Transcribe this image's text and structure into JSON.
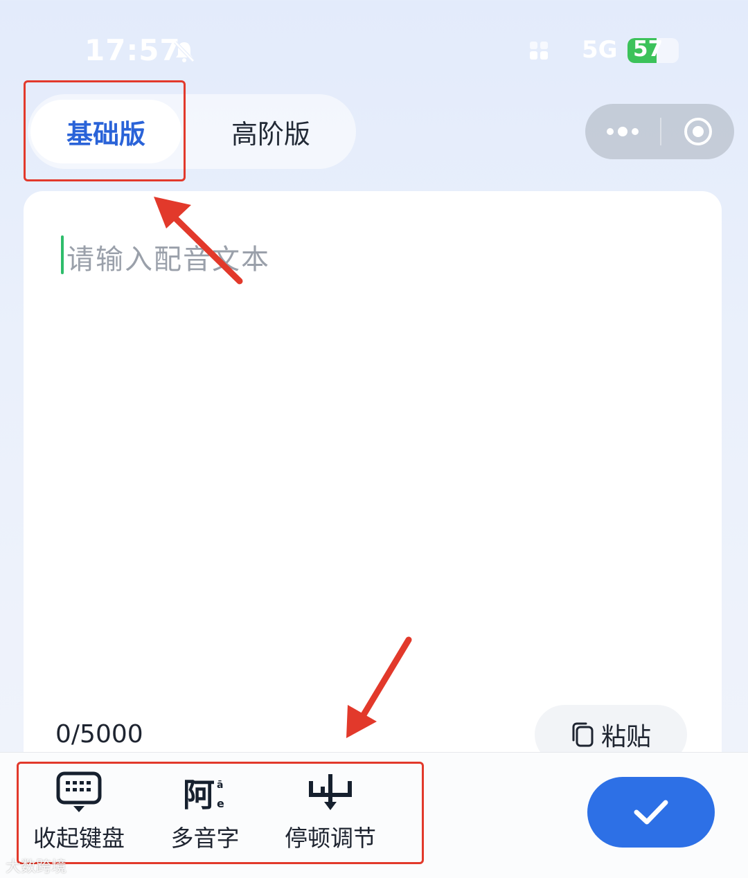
{
  "status_bar": {
    "time": "17:57",
    "network": "5G",
    "battery": "57",
    "battery_level": 0.57,
    "icons": [
      "bell-slash-icon",
      "signal-icon",
      "battery-icon"
    ]
  },
  "tabs": [
    {
      "label": "基础版",
      "selected": true
    },
    {
      "label": "高阶版",
      "selected": false
    }
  ],
  "mini_program_capsule": {
    "icons": [
      "more-dots-icon",
      "close-circle-icon"
    ]
  },
  "editor": {
    "placeholder": "请输入配音文本",
    "counter": "0/5000",
    "paste_label": "粘贴",
    "paste_icon": "clipboard-icon"
  },
  "toolbar": {
    "items": [
      {
        "label": "收起键盘",
        "icon": "keyboard-hide-icon"
      },
      {
        "label": "多音字",
        "icon": "polyphone-icon",
        "icon_text": "阿"
      },
      {
        "label": "停顿调节",
        "icon": "pause-adjust-icon"
      }
    ],
    "confirm_icon": "check-icon"
  },
  "colors": {
    "accent": "#2d70e6",
    "tab_active_text": "#2a63d8",
    "annotation": "#e2392b",
    "caret": "#2ebd6b"
  },
  "watermark": "大数跨境"
}
